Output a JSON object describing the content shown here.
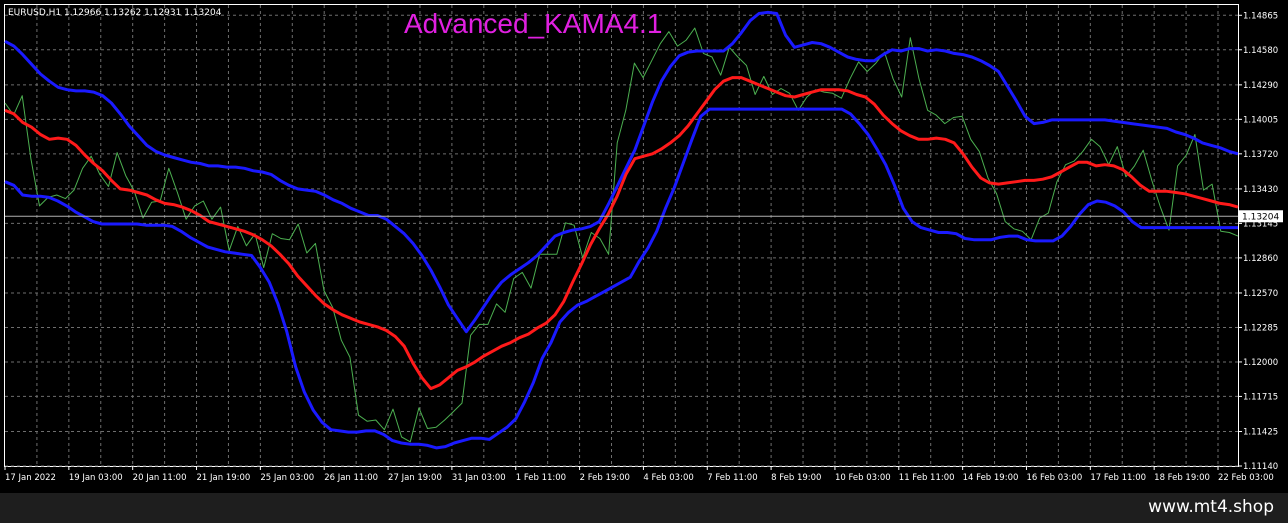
{
  "header": {
    "symbol_info": "EURUSD,H1  1.12966 1.13262 1.12931 1.13204",
    "indicator_title": "Advanced_KAMA4.1"
  },
  "footer": {
    "site": "www.mt4.shop"
  },
  "colors": {
    "background": "#000000",
    "frame": "#ffffff",
    "grid": "#6e6e6e",
    "price": "#4caf50",
    "mid_line": "#ff1a1a",
    "bands": "#1a1aff",
    "title": "#e020e0",
    "current_price_box": "#ffffff"
  },
  "chart_data": {
    "type": "line",
    "symbol": "EURUSD",
    "timeframe": "H1",
    "ylim": [
      1.1114,
      1.1495
    ],
    "current_price": 1.13204,
    "current_price_label": "1.13204",
    "y_ticks": [
      {
        "value": 1.14865,
        "label": "1.14865"
      },
      {
        "value": 1.1458,
        "label": "1.14580"
      },
      {
        "value": 1.1429,
        "label": "1.14290"
      },
      {
        "value": 1.14005,
        "label": "1.14005"
      },
      {
        "value": 1.1372,
        "label": "1.13720"
      },
      {
        "value": 1.1343,
        "label": "1.13430"
      },
      {
        "value": 1.13145,
        "label": "1.13145"
      },
      {
        "value": 1.1286,
        "label": "1.12860"
      },
      {
        "value": 1.1257,
        "label": "1.12570"
      },
      {
        "value": 1.12285,
        "label": "1.12285"
      },
      {
        "value": 1.12,
        "label": "1.12000"
      },
      {
        "value": 1.11715,
        "label": "1.11715"
      },
      {
        "value": 1.11425,
        "label": "1.11425"
      },
      {
        "value": 1.1114,
        "label": "1.11140"
      }
    ],
    "x_ticks": [
      "17 Jan 2022",
      "19 Jan 03:00",
      "20 Jan 11:00",
      "21 Jan 19:00",
      "25 Jan 03:00",
      "26 Jan 11:00",
      "27 Jan 19:00",
      "31 Jan 03:00",
      "1 Feb 11:00",
      "2 Feb 19:00",
      "4 Feb 03:00",
      "7 Feb 11:00",
      "8 Feb 19:00",
      "10 Feb 03:00",
      "11 Feb 11:00",
      "14 Feb 19:00",
      "16 Feb 03:00",
      "17 Feb 11:00",
      "18 Feb 19:00",
      "22 Feb 03:00"
    ],
    "series": [
      {
        "role": "upper_band",
        "values": [
          1.1465,
          1.1461,
          1.1454,
          1.1446,
          1.1438,
          1.1432,
          1.1427,
          1.1425,
          1.1424,
          1.1424,
          1.1423,
          1.142,
          1.1414,
          1.1405,
          1.1395,
          1.1387,
          1.1379,
          1.1374,
          1.1371,
          1.1369,
          1.1367,
          1.1365,
          1.1364,
          1.1362,
          1.1362,
          1.1361,
          1.1361,
          1.136,
          1.1358,
          1.1357,
          1.1355,
          1.135,
          1.1346,
          1.1343,
          1.1342,
          1.1341,
          1.1338,
          1.1334,
          1.1331,
          1.1327,
          1.1324,
          1.1321,
          1.1321,
          1.1318,
          1.1312,
          1.1306,
          1.1298,
          1.1288,
          1.1276,
          1.1262,
          1.1247,
          1.1236,
          1.1225,
          1.1235,
          1.1246,
          1.1257,
          1.1266,
          1.1272,
          1.1277,
          1.1282,
          1.1288,
          1.1296,
          1.1304,
          1.1307,
          1.1309,
          1.131,
          1.1312,
          1.1316,
          1.133,
          1.1345,
          1.136,
          1.1375,
          1.1395,
          1.1415,
          1.1432,
          1.1444,
          1.1453,
          1.1456,
          1.1457,
          1.1457,
          1.1457,
          1.1457,
          1.1463,
          1.1472,
          1.1482,
          1.1488,
          1.1489,
          1.1488,
          1.147,
          1.146,
          1.1462,
          1.1464,
          1.1463,
          1.146,
          1.1456,
          1.1452,
          1.145,
          1.1449,
          1.1449,
          1.1454,
          1.1458,
          1.1457,
          1.1459,
          1.1459,
          1.1457,
          1.1458,
          1.1457,
          1.1455,
          1.1454,
          1.1452,
          1.1449,
          1.1445,
          1.144,
          1.1428,
          1.1416,
          1.1403,
          1.1397,
          1.1398,
          1.14,
          1.14,
          1.14,
          1.14,
          1.14,
          1.14,
          1.14,
          1.1399,
          1.1398,
          1.1397,
          1.1396,
          1.1395,
          1.1394,
          1.1393,
          1.139,
          1.1388,
          1.1385,
          1.1381,
          1.1379,
          1.1377,
          1.1374,
          1.1372
        ]
      },
      {
        "role": "kama",
        "values": [
          1.1408,
          1.1405,
          1.1398,
          1.1394,
          1.1388,
          1.1384,
          1.1385,
          1.1384,
          1.1379,
          1.1371,
          1.1364,
          1.1358,
          1.135,
          1.1343,
          1.1342,
          1.134,
          1.1338,
          1.1334,
          1.1331,
          1.133,
          1.1328,
          1.1325,
          1.1321,
          1.1316,
          1.1314,
          1.1312,
          1.131,
          1.1308,
          1.1305,
          1.1301,
          1.1296,
          1.1289,
          1.1281,
          1.1271,
          1.1263,
          1.1255,
          1.1248,
          1.1243,
          1.1239,
          1.1236,
          1.1233,
          1.1231,
          1.1229,
          1.1226,
          1.1221,
          1.1213,
          1.1199,
          1.1187,
          1.1178,
          1.1181,
          1.1187,
          1.1193,
          1.1196,
          1.12,
          1.1205,
          1.1209,
          1.1213,
          1.1216,
          1.122,
          1.1223,
          1.1228,
          1.1232,
          1.1239,
          1.125,
          1.1266,
          1.1281,
          1.1297,
          1.131,
          1.1322,
          1.1337,
          1.1355,
          1.1368,
          1.137,
          1.1372,
          1.1376,
          1.1381,
          1.1387,
          1.1395,
          1.1405,
          1.1415,
          1.1425,
          1.1432,
          1.1435,
          1.1435,
          1.1432,
          1.1429,
          1.1426,
          1.1423,
          1.142,
          1.1419,
          1.1421,
          1.1423,
          1.1425,
          1.1425,
          1.1425,
          1.1424,
          1.1421,
          1.1419,
          1.1413,
          1.1404,
          1.1397,
          1.1391,
          1.1387,
          1.1384,
          1.1384,
          1.1385,
          1.1384,
          1.1381,
          1.1372,
          1.1361,
          1.1352,
          1.1348,
          1.1347,
          1.1348,
          1.1349,
          1.135,
          1.135,
          1.1351,
          1.1353,
          1.1357,
          1.1361,
          1.1365,
          1.1365,
          1.1362,
          1.1363,
          1.1362,
          1.1359,
          1.1353,
          1.1346,
          1.1341,
          1.1341,
          1.1341,
          1.134,
          1.1339,
          1.1337,
          1.1335,
          1.1333,
          1.1331,
          1.133,
          1.1328
        ]
      },
      {
        "role": "lower_band",
        "values": [
          1.1349,
          1.1346,
          1.1338,
          1.1337,
          1.1337,
          1.1336,
          1.1333,
          1.1329,
          1.1324,
          1.132,
          1.1316,
          1.1314,
          1.1314,
          1.1314,
          1.1314,
          1.1314,
          1.1313,
          1.1313,
          1.1313,
          1.1312,
          1.1308,
          1.1303,
          1.1299,
          1.1295,
          1.1293,
          1.1291,
          1.129,
          1.1289,
          1.1288,
          1.1278,
          1.1266,
          1.1248,
          1.1225,
          1.1196,
          1.1175,
          1.116,
          1.115,
          1.1144,
          1.1143,
          1.1142,
          1.1142,
          1.1143,
          1.1143,
          1.114,
          1.1135,
          1.1133,
          1.1132,
          1.1132,
          1.1131,
          1.1129,
          1.113,
          1.1133,
          1.1135,
          1.1137,
          1.1137,
          1.1136,
          1.1141,
          1.1146,
          1.1153,
          1.1167,
          1.1183,
          1.1203,
          1.1216,
          1.1233,
          1.1241,
          1.1247,
          1.125,
          1.1254,
          1.1258,
          1.1262,
          1.1266,
          1.127,
          1.1283,
          1.1294,
          1.1308,
          1.1327,
          1.1344,
          1.1364,
          1.1384,
          1.1403,
          1.1409,
          1.1409,
          1.1409,
          1.1409,
          1.1409,
          1.1409,
          1.1409,
          1.1409,
          1.1409,
          1.1409,
          1.1409,
          1.1409,
          1.1409,
          1.1409,
          1.1409,
          1.1409,
          1.1405,
          1.1397,
          1.1388,
          1.1376,
          1.1363,
          1.1346,
          1.1327,
          1.1316,
          1.1311,
          1.1309,
          1.1307,
          1.1307,
          1.1306,
          1.1302,
          1.1301,
          1.1301,
          1.1301,
          1.1303,
          1.1304,
          1.1304,
          1.1301,
          1.13,
          1.13,
          1.13,
          1.1304,
          1.1312,
          1.1322,
          1.133,
          1.1333,
          1.1332,
          1.1329,
          1.1324,
          1.1316,
          1.1311,
          1.1311,
          1.1311,
          1.1311,
          1.1311,
          1.1311,
          1.1311,
          1.1311,
          1.1311,
          1.1311,
          1.1311,
          1.1311
        ]
      },
      {
        "role": "price",
        "values": [
          1.1414,
          1.1404,
          1.142,
          1.1368,
          1.1329,
          1.1336,
          1.1338,
          1.1335,
          1.1342,
          1.136,
          1.137,
          1.1355,
          1.1345,
          1.1373,
          1.1354,
          1.1341,
          1.1319,
          1.1332,
          1.1333,
          1.136,
          1.134,
          1.1318,
          1.1329,
          1.1333,
          1.1318,
          1.1328,
          1.1292,
          1.1312,
          1.1296,
          1.1306,
          1.1278,
          1.1306,
          1.1302,
          1.1301,
          1.1314,
          1.129,
          1.1298,
          1.1259,
          1.1245,
          1.1218,
          1.1204,
          1.1156,
          1.1151,
          1.1152,
          1.1144,
          1.1161,
          1.1138,
          1.1134,
          1.1162,
          1.1145,
          1.1146,
          1.1152,
          1.1159,
          1.1166,
          1.1222,
          1.1231,
          1.1231,
          1.1248,
          1.1241,
          1.1269,
          1.1274,
          1.1261,
          1.1289,
          1.1289,
          1.1289,
          1.1315,
          1.1313,
          1.1286,
          1.1307,
          1.1302,
          1.1289,
          1.1381,
          1.1408,
          1.1447,
          1.1435,
          1.1449,
          1.1463,
          1.1473,
          1.1461,
          1.1466,
          1.1476,
          1.1455,
          1.1452,
          1.1437,
          1.146,
          1.1452,
          1.1445,
          1.1421,
          1.1436,
          1.1421,
          1.1426,
          1.1422,
          1.1408,
          1.1419,
          1.1425,
          1.1423,
          1.1422,
          1.1418,
          1.1434,
          1.1448,
          1.144,
          1.1447,
          1.1456,
          1.1434,
          1.1419,
          1.1468,
          1.1434,
          1.1408,
          1.1404,
          1.1397,
          1.1402,
          1.1403,
          1.1384,
          1.1374,
          1.1352,
          1.1339,
          1.1316,
          1.131,
          1.1308,
          1.1301,
          1.1319,
          1.1323,
          1.1349,
          1.1363,
          1.1366,
          1.1374,
          1.1384,
          1.1378,
          1.1363,
          1.1378,
          1.1353,
          1.1362,
          1.1375,
          1.135,
          1.1328,
          1.1309,
          1.1362,
          1.1371,
          1.1388,
          1.1342,
          1.1347,
          1.1308,
          1.1307,
          1.1304
        ]
      }
    ]
  }
}
